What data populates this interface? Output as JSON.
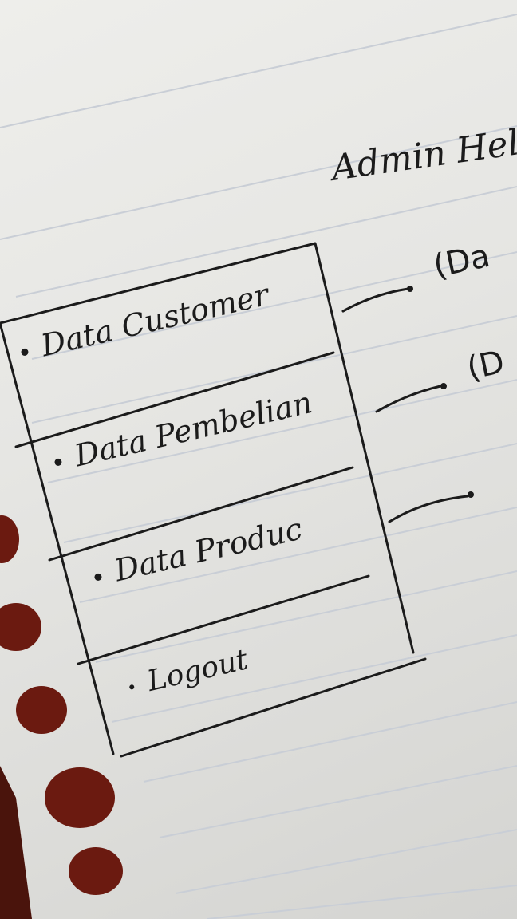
{
  "page": {
    "title": "Admin Hel"
  },
  "menu": {
    "items": [
      {
        "label": "Data Customer"
      },
      {
        "label": "Data Pembelian"
      },
      {
        "label": "Data Produc"
      },
      {
        "label": "Logout"
      }
    ]
  },
  "annotations": {
    "note1": "(Da",
    "note2": "(D"
  },
  "colors": {
    "ink": "#1b1b1b",
    "paper": "#e6e6e3",
    "rule": "#c9ced6",
    "punch_hole": "#6b1a10"
  }
}
